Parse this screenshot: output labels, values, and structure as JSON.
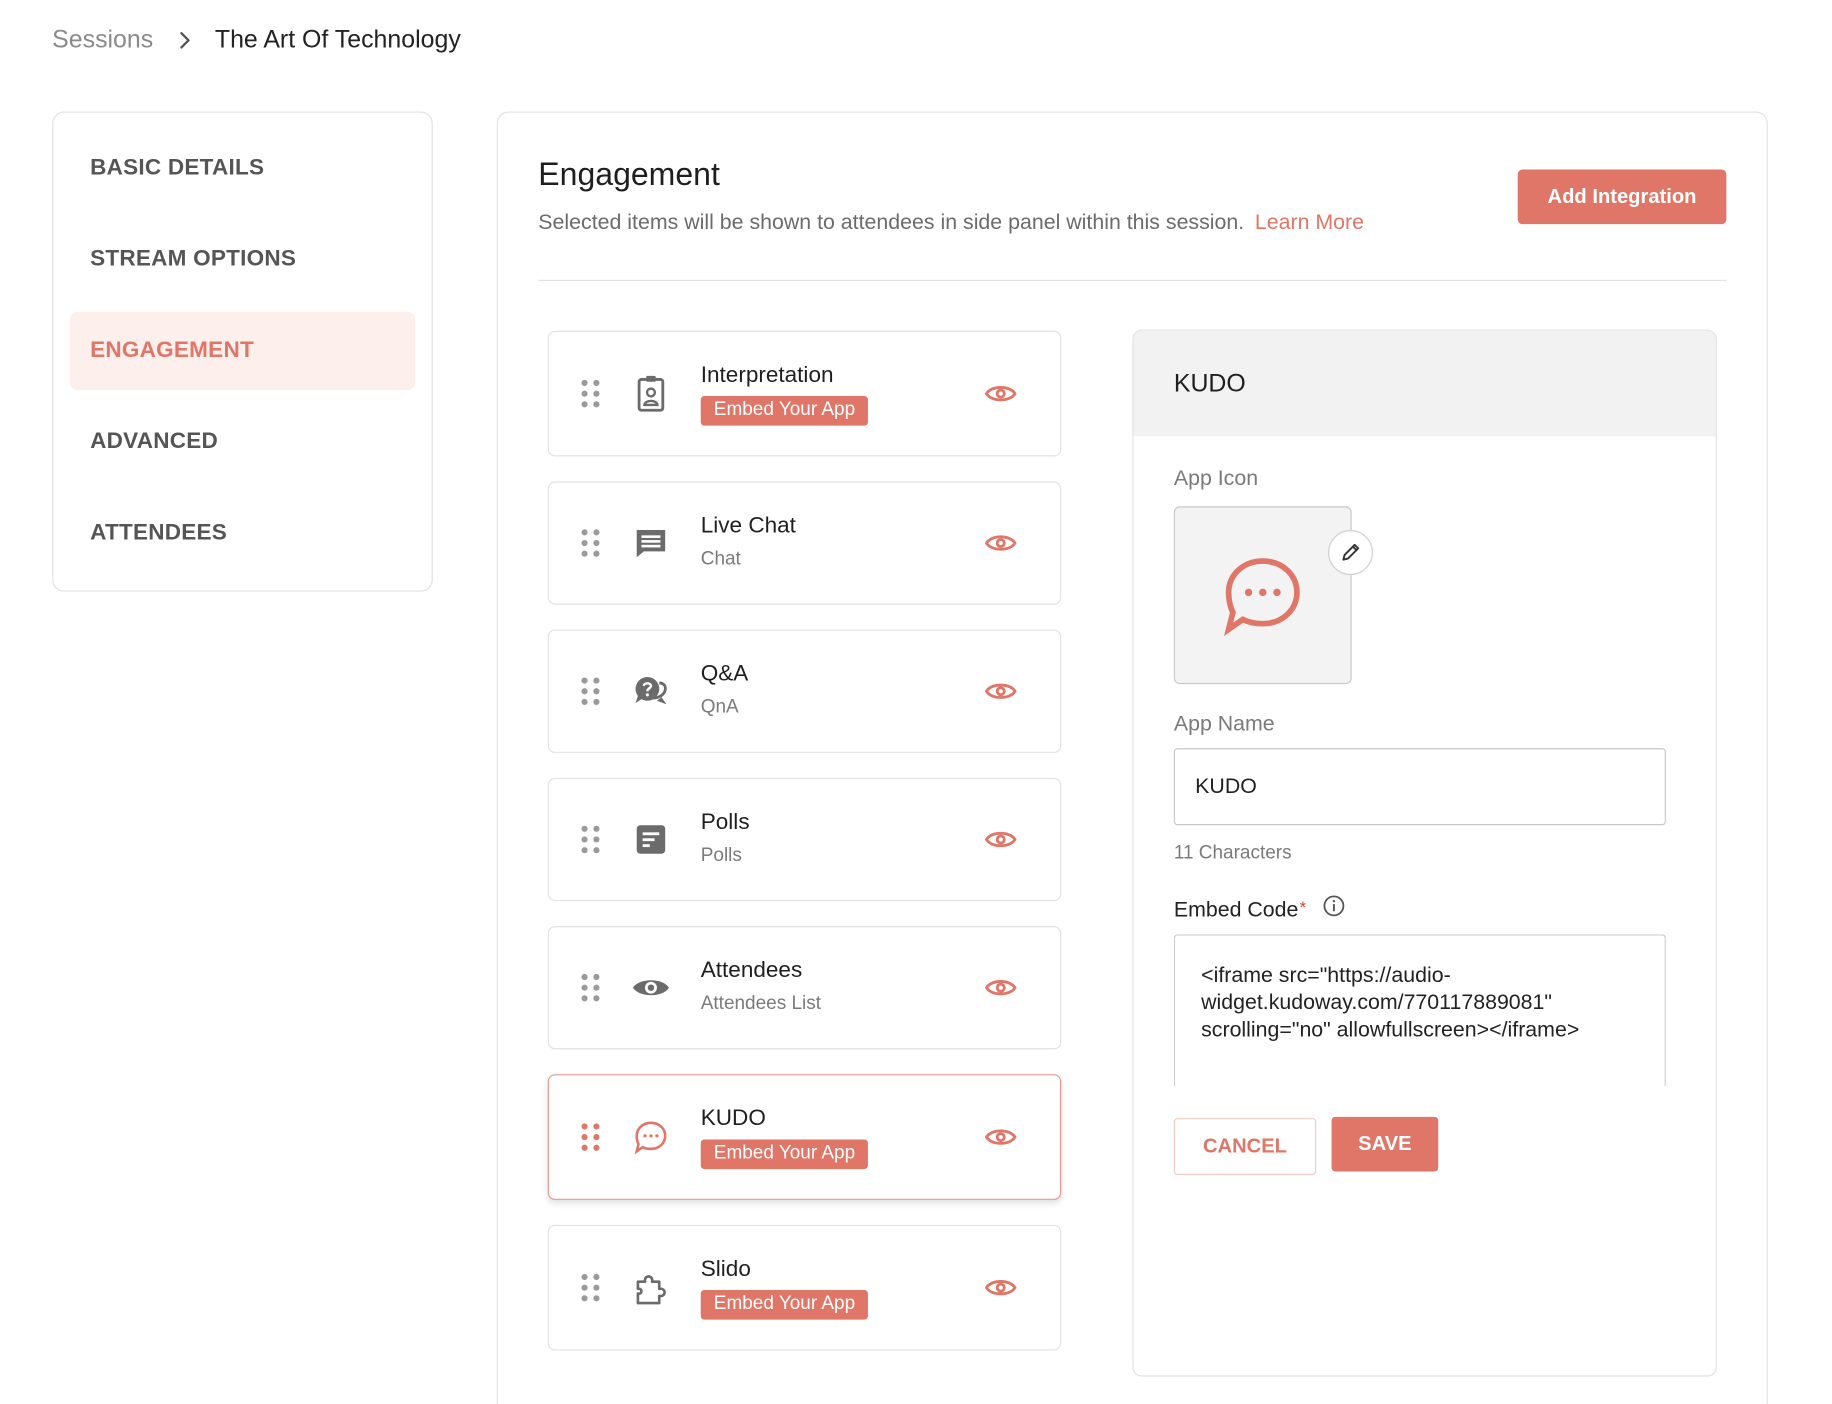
{
  "breadcrumb": {
    "parent": "Sessions",
    "current": "The Art Of Technology"
  },
  "nav": {
    "items": [
      {
        "label": "BASIC DETAILS",
        "active": false
      },
      {
        "label": "STREAM OPTIONS",
        "active": false
      },
      {
        "label": "ENGAGEMENT",
        "active": true
      },
      {
        "label": "ADVANCED",
        "active": false
      },
      {
        "label": "ATTENDEES",
        "active": false
      }
    ]
  },
  "engagement": {
    "title": "Engagement",
    "description": "Selected items will be shown to attendees in side panel within this session.",
    "learn_more": "Learn More",
    "add_button": "Add Integration"
  },
  "integrations": [
    {
      "name": "Interpretation",
      "badge": "Embed Your App",
      "icon": "contact-badge-icon",
      "visible": true
    },
    {
      "name": "Live Chat",
      "subtitle": "Chat",
      "icon": "chat-lines-icon",
      "visible": true
    },
    {
      "name": "Q&A",
      "subtitle": "QnA",
      "icon": "question-bubbles-icon",
      "visible": true
    },
    {
      "name": "Polls",
      "subtitle": "Polls",
      "icon": "poll-icon",
      "visible": true
    },
    {
      "name": "Attendees",
      "subtitle": "Attendees List",
      "icon": "eye-icon",
      "visible": true
    },
    {
      "name": "KUDO",
      "badge": "Embed Your App",
      "icon": "chat-dots-icon",
      "visible": true,
      "selected": true
    },
    {
      "name": "Slido",
      "badge": "Embed Your App",
      "icon": "puzzle-icon",
      "visible": true
    }
  ],
  "detail": {
    "title": "KUDO",
    "app_icon_label": "App Icon",
    "app_name_label": "App Name",
    "app_name_value": "KUDO",
    "char_count": "11 Characters",
    "embed_code_label": "Embed Code",
    "required_mark": "*",
    "embed_code_value": "<iframe src=\"https://audio-widget.kudoway.com/770117889081\" scrolling=\"no\" allowfullscreen></iframe>",
    "cancel_label": "CANCEL",
    "save_label": "SAVE"
  },
  "colors": {
    "accent": "#e07667",
    "accent_light": "#fcefec",
    "border": "#e2e2e2",
    "icon_gray": "#6b6b6b"
  }
}
